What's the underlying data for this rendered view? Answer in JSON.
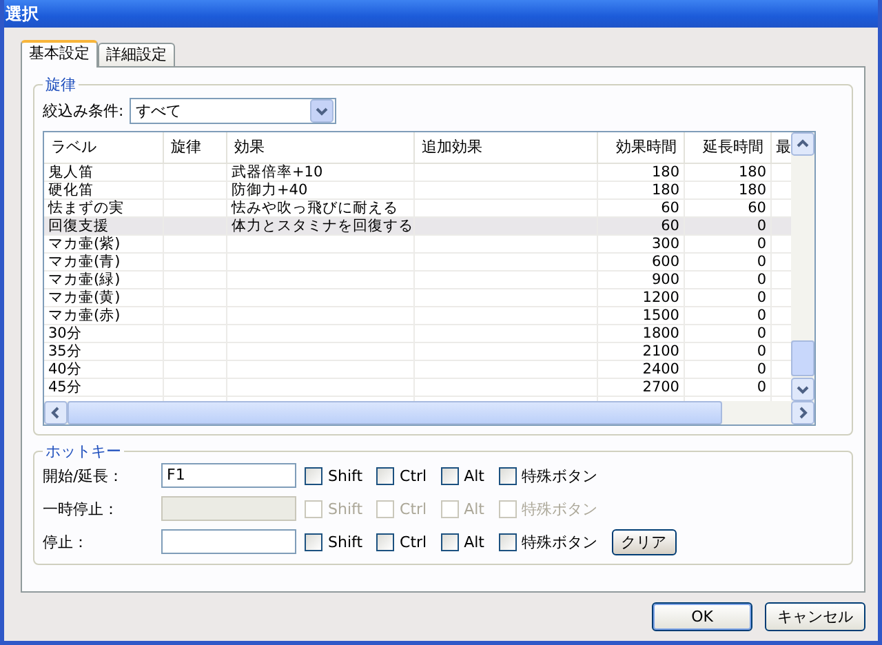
{
  "window": {
    "title": "選択"
  },
  "tabs": [
    {
      "label": "基本設定",
      "selected": true
    },
    {
      "label": "詳細設定",
      "selected": false
    }
  ],
  "melody_group": {
    "title": "旋律",
    "filter_label": "絞込み条件:",
    "filter_value": "すべて"
  },
  "table": {
    "columns": [
      "ラベル",
      "旋律",
      "効果",
      "追加効果",
      "効果時間",
      "延長時間",
      "最"
    ],
    "rows": [
      {
        "selected": false,
        "cells": [
          "鬼人笛",
          "",
          "武器倍率+10",
          "",
          "180",
          "180",
          ""
        ]
      },
      {
        "selected": false,
        "cells": [
          "硬化笛",
          "",
          "防御力+40",
          "",
          "180",
          "180",
          ""
        ]
      },
      {
        "selected": false,
        "cells": [
          "怯まずの実",
          "",
          "怯みや吹っ飛びに耐える",
          "",
          "60",
          "60",
          ""
        ]
      },
      {
        "selected": true,
        "cells": [
          "回復支援",
          "",
          "体力とスタミナを回復する",
          "",
          "60",
          "0",
          ""
        ]
      },
      {
        "selected": false,
        "cells": [
          "マカ壷(紫)",
          "",
          "",
          "",
          "300",
          "0",
          ""
        ]
      },
      {
        "selected": false,
        "cells": [
          "マカ壷(青)",
          "",
          "",
          "",
          "600",
          "0",
          ""
        ]
      },
      {
        "selected": false,
        "cells": [
          "マカ壷(緑)",
          "",
          "",
          "",
          "900",
          "0",
          ""
        ]
      },
      {
        "selected": false,
        "cells": [
          "マカ壷(黄)",
          "",
          "",
          "",
          "1200",
          "0",
          ""
        ]
      },
      {
        "selected": false,
        "cells": [
          "マカ壷(赤)",
          "",
          "",
          "",
          "1500",
          "0",
          ""
        ]
      },
      {
        "selected": false,
        "cells": [
          "30分",
          "",
          "",
          "",
          "1800",
          "0",
          ""
        ]
      },
      {
        "selected": false,
        "cells": [
          "35分",
          "",
          "",
          "",
          "2100",
          "0",
          ""
        ]
      },
      {
        "selected": false,
        "cells": [
          "40分",
          "",
          "",
          "",
          "2400",
          "0",
          ""
        ]
      },
      {
        "selected": false,
        "cells": [
          "45分",
          "",
          "",
          "",
          "2700",
          "0",
          ""
        ]
      }
    ]
  },
  "hotkey_group": {
    "title": "ホットキー",
    "rows": [
      {
        "label": "開始/延長：",
        "value": "F1",
        "disabled": false,
        "checkboxes": [
          {
            "label": "Shift",
            "checked": false
          },
          {
            "label": "Ctrl",
            "checked": false
          },
          {
            "label": "Alt",
            "checked": false
          },
          {
            "label": "特殊ボタン",
            "checked": false
          }
        ]
      },
      {
        "label": "一時停止：",
        "value": "",
        "disabled": true,
        "checkboxes": [
          {
            "label": "Shift",
            "checked": false
          },
          {
            "label": "Ctrl",
            "checked": false
          },
          {
            "label": "Alt",
            "checked": false
          },
          {
            "label": "特殊ボタン",
            "checked": false
          }
        ]
      },
      {
        "label": "停止：",
        "value": "",
        "disabled": false,
        "checkboxes": [
          {
            "label": "Shift",
            "checked": false
          },
          {
            "label": "Ctrl",
            "checked": false
          },
          {
            "label": "Alt",
            "checked": false
          },
          {
            "label": "特殊ボタン",
            "checked": false
          }
        ],
        "button": "クリア"
      }
    ]
  },
  "buttons": [
    "OK",
    "キャンセル"
  ]
}
